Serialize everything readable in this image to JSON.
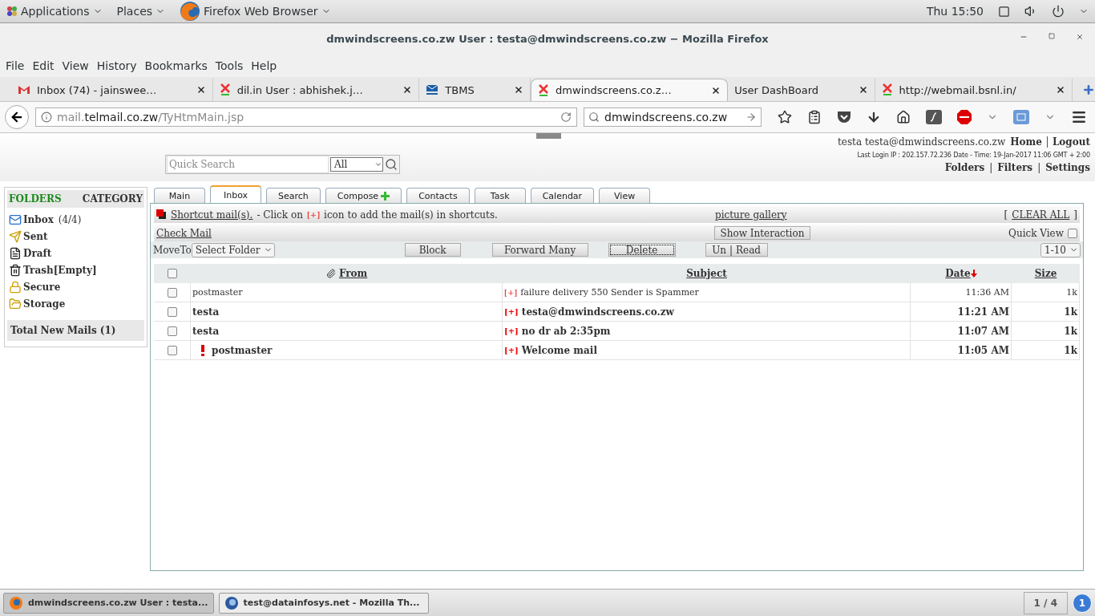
{
  "top_bar": {
    "applications": "Applications",
    "places": "Places",
    "app_menu": "Firefox Web Browser",
    "clock": "Thu 15:50"
  },
  "window": {
    "title": "dmwindscreens.co.zw User : testa@dmwindscreens.co.zw − Mozilla Firefox"
  },
  "menu": [
    "File",
    "Edit",
    "View",
    "History",
    "Bookmarks",
    "Tools",
    "Help"
  ],
  "browser_tabs": [
    {
      "label": "Inbox (74) - jainswee…",
      "kind": "gmail",
      "selected": false
    },
    {
      "label": "dil.in User : abhishek.j…",
      "kind": "xgen",
      "selected": false
    },
    {
      "label": "TBMS",
      "kind": "tbms",
      "selected": false
    },
    {
      "label": "dmwindscreens.co.z…",
      "kind": "xgen",
      "selected": true
    },
    {
      "label": "User DashBoard",
      "kind": "plain",
      "selected": false
    },
    {
      "label": "http://webmail.bsnl.in/",
      "kind": "xgen",
      "selected": false
    }
  ],
  "url": {
    "prefix": "mail.",
    "domain": "telmail.co.zw",
    "path": "/TyHtmMain.jsp"
  },
  "browser_search": {
    "value": "dmwindscreens.co.zw"
  },
  "header": {
    "quick_search": {
      "placeholder": "Quick Search"
    },
    "scope": "All",
    "user": "testa testa@dmwindscreens.co.zw",
    "home": "Home",
    "logout": "Logout",
    "last_login": "Last Login IP : 202.157.72.236 Date - Time: 19-Jan-2017 11:06 GMT + 2:00",
    "links": [
      "Folders",
      "Filters",
      "Settings"
    ],
    "link_separators": [
      "|",
      "|"
    ]
  },
  "sidebar": {
    "folders_title": "FOLDERS",
    "category_title": "CATEGORY",
    "items": [
      {
        "kind": "inbox",
        "name": "Inbox",
        "count": "(4/4)"
      },
      {
        "kind": "sent",
        "name": "Sent"
      },
      {
        "kind": "draft",
        "name": "Draft"
      },
      {
        "kind": "trash",
        "name": "Trash[Empty]"
      },
      {
        "kind": "secure",
        "name": "Secure"
      },
      {
        "kind": "storage",
        "name": "Storage"
      }
    ],
    "total": "Total New Mails (1)"
  },
  "mail_tabs": [
    {
      "label": "Main",
      "selected": false,
      "plus": false
    },
    {
      "label": "Inbox",
      "selected": true,
      "plus": false
    },
    {
      "label": "Search",
      "selected": false,
      "plus": false
    },
    {
      "label": "Compose",
      "selected": false,
      "plus": true
    },
    {
      "label": "Contacts",
      "selected": false,
      "plus": false
    },
    {
      "label": "Task",
      "selected": false,
      "plus": false
    },
    {
      "label": "Calendar",
      "selected": false,
      "plus": false
    },
    {
      "label": "View",
      "selected": false,
      "plus": false
    }
  ],
  "shortcut_bar": {
    "link": "Shortcut mail(s).",
    "text_before": "- Click on",
    "marker": "[+]",
    "text_after": "icon to add the mail(s) in shortcuts.",
    "gallery": "picture gallery",
    "open_bracket": "[",
    "clear_all": "CLEAR ALL",
    "close_bracket": "]"
  },
  "actions": {
    "check_mail": "Check Mail",
    "show_interaction": "Show Interaction",
    "quick_view": {
      "label": "Quick View",
      "checked": false
    },
    "move_to": "MoveTo",
    "folder_select": "Select Folder",
    "buttons": [
      {
        "label": "Block",
        "focused": false
      },
      {
        "label": "Forward Many",
        "focused": false
      },
      {
        "label": "Delete",
        "focused": true
      }
    ],
    "unread": "Un",
    "unread_separator": "|",
    "read": "Read",
    "page_select": "1-10"
  },
  "table": {
    "columns": [
      "From",
      "Subject",
      "Date",
      "Size"
    ],
    "select_all": false,
    "rows": [
      {
        "from": "postmaster",
        "marker": "[+]",
        "subject": "failure delivery 550 Sender is Spammer",
        "date": "11:36 AM",
        "size": "1k",
        "unread": false,
        "important": false,
        "checked": false
      },
      {
        "from": "testa",
        "marker": "[+]",
        "subject": "testa@dmwindscreens.co.zw",
        "date": "11:21 AM",
        "size": "1k",
        "unread": true,
        "important": false,
        "checked": false
      },
      {
        "from": "testa",
        "marker": "[+]",
        "subject": "no dr ab 2:35pm",
        "date": "11:07 AM",
        "size": "1k",
        "unread": true,
        "important": false,
        "checked": false
      },
      {
        "from": "postmaster",
        "marker": "[+]",
        "subject": "Welcome mail",
        "date": "11:05 AM",
        "size": "1k",
        "unread": true,
        "important": true,
        "checked": false
      }
    ]
  },
  "taskbar": {
    "items": [
      {
        "label": "dmwindscreens.co.zw User : testa...",
        "selected": true
      },
      {
        "label": "test@datainfosys.net - Mozilla Th...",
        "selected": false
      }
    ],
    "workspace": "1 / 4",
    "notifications": "1"
  }
}
